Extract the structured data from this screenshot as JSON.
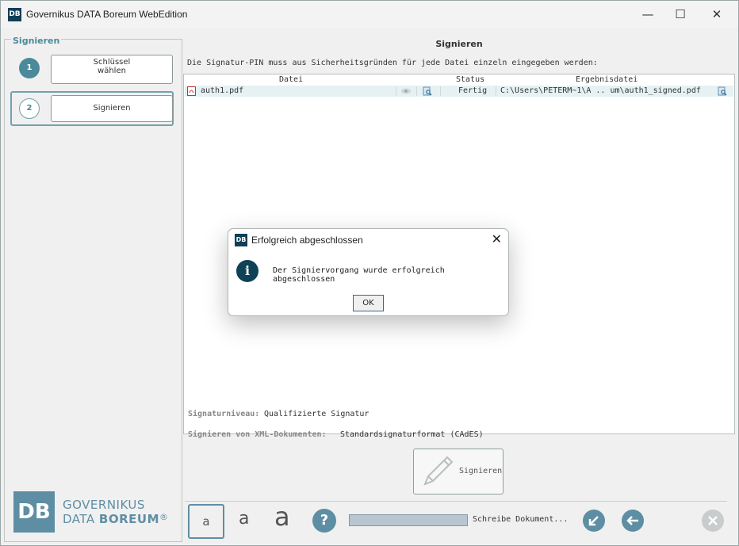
{
  "window": {
    "app_icon": "DB",
    "title": "Governikus DATA Boreum WebEdition",
    "controls": {
      "minimize": "—",
      "maximize": "☐",
      "close": "✕"
    }
  },
  "sidebar": {
    "legend": "Signieren",
    "steps": [
      {
        "number": "1",
        "label_line1": "Schlüssel",
        "label_line2": "wählen"
      },
      {
        "number": "2",
        "label": "Signieren"
      }
    ],
    "logo": {
      "mark": "DB",
      "line1": "GOVERNIKUS",
      "line2_a": "DATA ",
      "line2_b": "BOREUM",
      "reg": "®"
    }
  },
  "main": {
    "title": "Signieren",
    "hint": "Die Signatur-PIN muss aus Sicherheitsgründen für jede Datei einzeln eingegeben werden:",
    "table": {
      "columns": [
        "Datei",
        "Status",
        "Ergebnisdatei"
      ],
      "rows": [
        {
          "file": "auth1.pdf",
          "status": "Fertig",
          "result": "C:\\Users\\PETERM~1\\A .. um\\auth1_signed.pdf"
        }
      ]
    },
    "signature_level_label": "Signaturniveau:",
    "signature_level_value": "Qualifizierte Signatur",
    "xml_label": "Signieren von XML-Dokumenten:",
    "xml_value": "Standardsignaturformat (CAdES)",
    "sign_button_label": "Signieren"
  },
  "bottom": {
    "font_small": "a",
    "font_medium": "a",
    "font_large": "a",
    "help": "?",
    "progress_text": "Schreibe Dokument...",
    "progress_fraction": 1.0
  },
  "dialog": {
    "icon": "DB",
    "title": "Erfolgreich abgeschlossen",
    "close": "✕",
    "info_icon": "i",
    "message": "Der Signiervorgang wurde erfolgreich abgeschlossen",
    "ok_label": "OK"
  },
  "colors": {
    "accent": "#0f4157",
    "teal": "#4b8a9a",
    "row_highlight": "#e6f1f4"
  }
}
